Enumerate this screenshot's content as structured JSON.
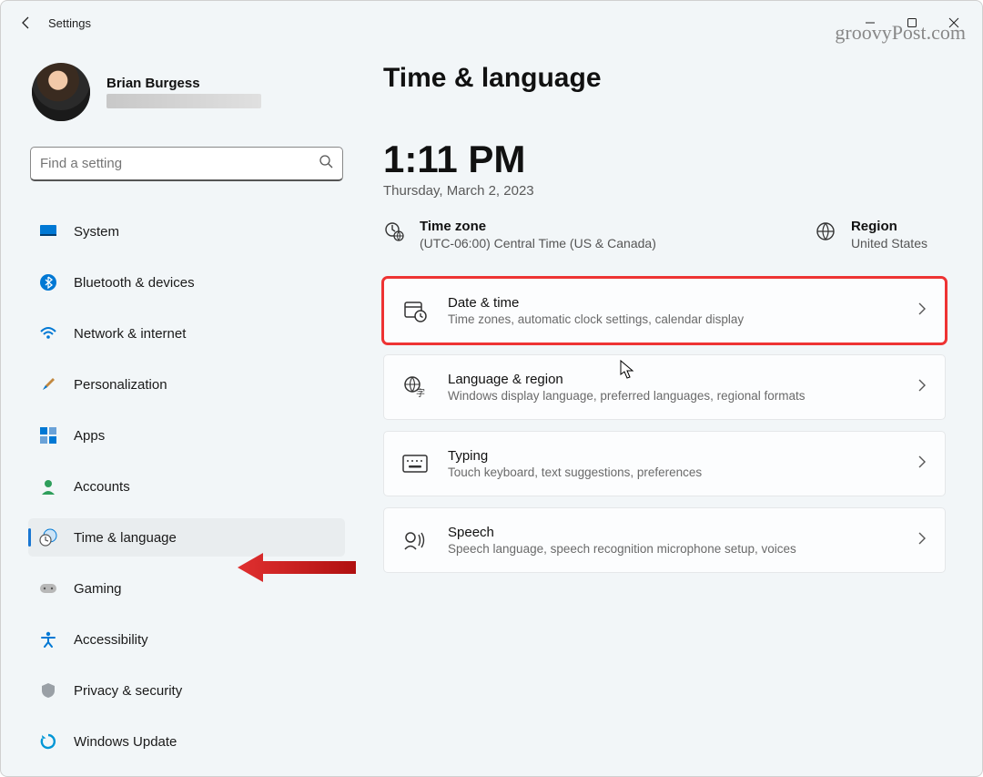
{
  "app": {
    "title": "Settings"
  },
  "watermark": "groovyPost.com",
  "profile": {
    "name": "Brian Burgess"
  },
  "search": {
    "placeholder": "Find a setting"
  },
  "nav": {
    "items": [
      {
        "label": "System"
      },
      {
        "label": "Bluetooth & devices"
      },
      {
        "label": "Network & internet"
      },
      {
        "label": "Personalization"
      },
      {
        "label": "Apps"
      },
      {
        "label": "Accounts"
      },
      {
        "label": "Time & language"
      },
      {
        "label": "Gaming"
      },
      {
        "label": "Accessibility"
      },
      {
        "label": "Privacy & security"
      },
      {
        "label": "Windows Update"
      }
    ]
  },
  "page": {
    "title": "Time & language",
    "clock": "1:11 PM",
    "date": "Thursday, March 2, 2023",
    "timezone": {
      "label": "Time zone",
      "value": "(UTC-06:00) Central Time (US & Canada)"
    },
    "region": {
      "label": "Region",
      "value": "United States"
    },
    "cards": [
      {
        "title": "Date & time",
        "sub": "Time zones, automatic clock settings, calendar display"
      },
      {
        "title": "Language & region",
        "sub": "Windows display language, preferred languages, regional formats"
      },
      {
        "title": "Typing",
        "sub": "Touch keyboard, text suggestions, preferences"
      },
      {
        "title": "Speech",
        "sub": "Speech language, speech recognition microphone setup, voices"
      }
    ]
  }
}
